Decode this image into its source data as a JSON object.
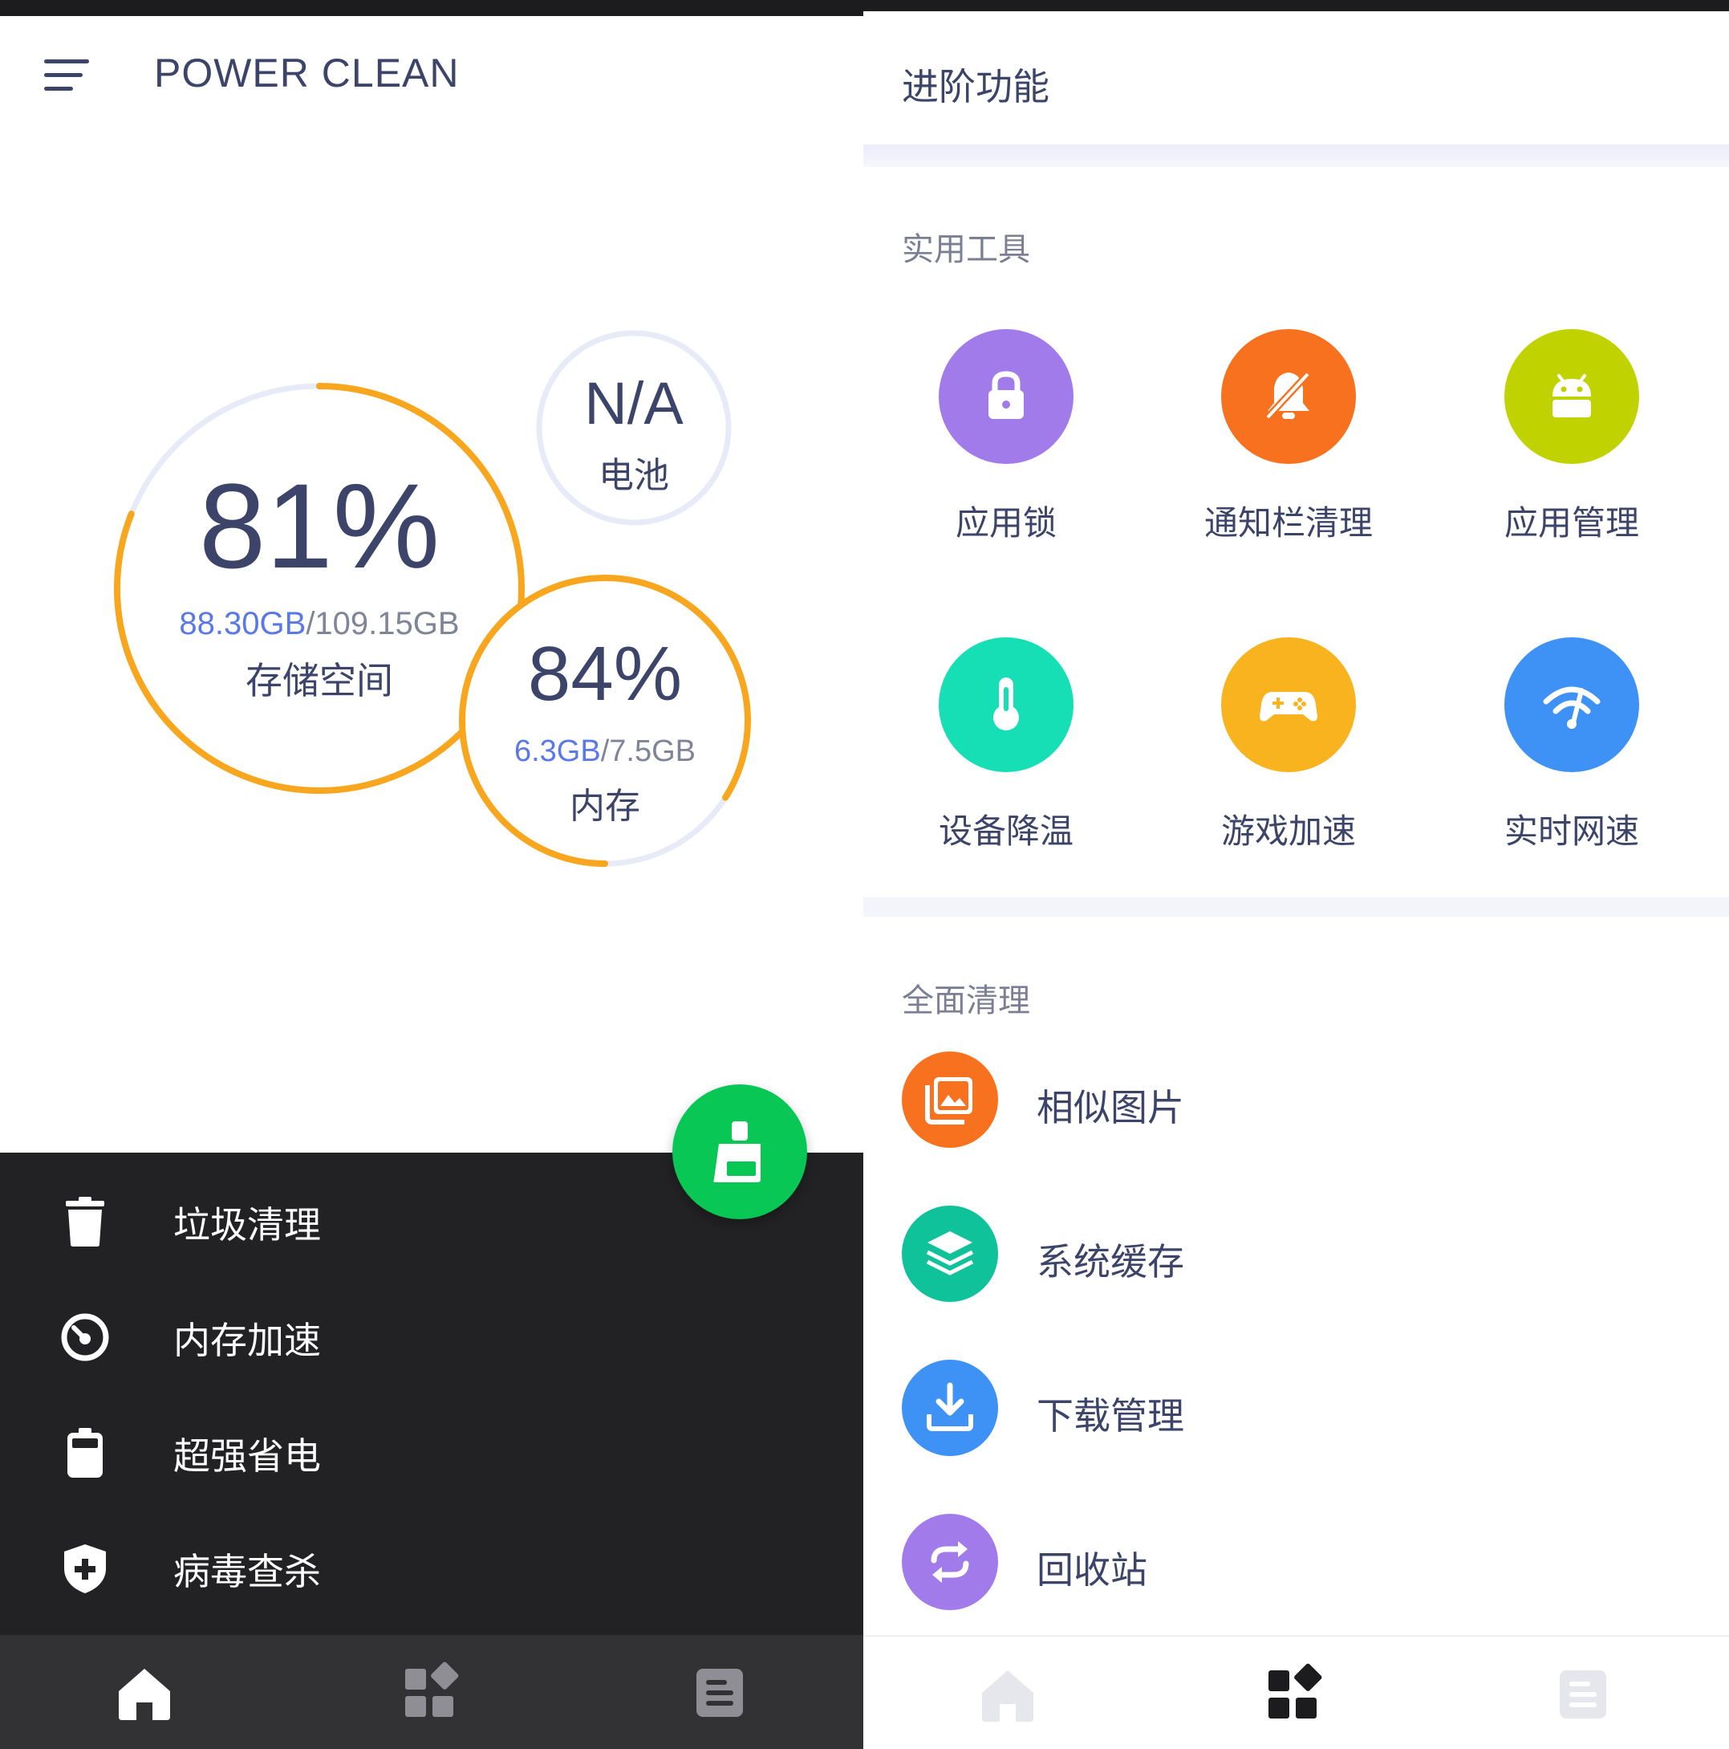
{
  "home": {
    "title": "POWER CLEAN",
    "storage": {
      "percent": "81%",
      "used": "88.30GB",
      "total": "/109.15GB",
      "label": "存储空间",
      "fill_fraction": 0.81
    },
    "battery": {
      "value": "N/A",
      "label": "电池"
    },
    "memory": {
      "percent": "84%",
      "used": "6.3GB",
      "total": "/7.5GB",
      "label": "内存",
      "fill_fraction": 0.84
    },
    "actions": [
      {
        "label": "垃圾清理",
        "icon": "trash-icon"
      },
      {
        "label": "内存加速",
        "icon": "speedometer-icon"
      },
      {
        "label": "超强省电",
        "icon": "battery-icon"
      },
      {
        "label": "病毒查杀",
        "icon": "shield-plus-icon"
      }
    ],
    "fab_icon": "broom-icon",
    "nav": [
      {
        "icon": "home-icon",
        "active": true
      },
      {
        "icon": "apps-grid-icon",
        "active": false
      },
      {
        "icon": "document-icon",
        "active": false
      }
    ]
  },
  "advanced": {
    "title": "进阶功能",
    "tools_section": "实用工具",
    "tools": [
      {
        "label": "应用锁",
        "icon": "lock-icon",
        "color": "#a27bea"
      },
      {
        "label": "通知栏清理",
        "icon": "bell-off-icon",
        "color": "#f7711f"
      },
      {
        "label": "应用管理",
        "icon": "android-icon",
        "color": "#c0d300"
      },
      {
        "label": "设备降温",
        "icon": "thermometer-icon",
        "color": "#17dfb5"
      },
      {
        "label": "游戏加速",
        "icon": "gamepad-icon",
        "color": "#f8b31e"
      },
      {
        "label": "实时网速",
        "icon": "wifi-speed-icon",
        "color": "#3e92f6"
      }
    ],
    "clean_section": "全面清理",
    "clean_items": [
      {
        "label": "相似图片",
        "icon": "photos-icon",
        "color": "#f7711f"
      },
      {
        "label": "系统缓存",
        "icon": "layers-icon",
        "color": "#10c29a"
      },
      {
        "label": "下载管理",
        "icon": "download-icon",
        "color": "#3e92f6"
      },
      {
        "label": "回收站",
        "icon": "recycle-icon",
        "color": "#a27bea"
      }
    ],
    "nav": [
      {
        "icon": "home-icon",
        "active": false
      },
      {
        "icon": "apps-grid-icon",
        "active": true
      },
      {
        "icon": "document-icon",
        "active": false
      }
    ]
  },
  "colors": {
    "ring_orange": "#f8a61e",
    "ring_track": "#e7ebf8",
    "fab_green": "#08c755",
    "panel_dark": "#222224",
    "text_primary": "#3c4469",
    "accent_blue": "#5a78e6"
  }
}
